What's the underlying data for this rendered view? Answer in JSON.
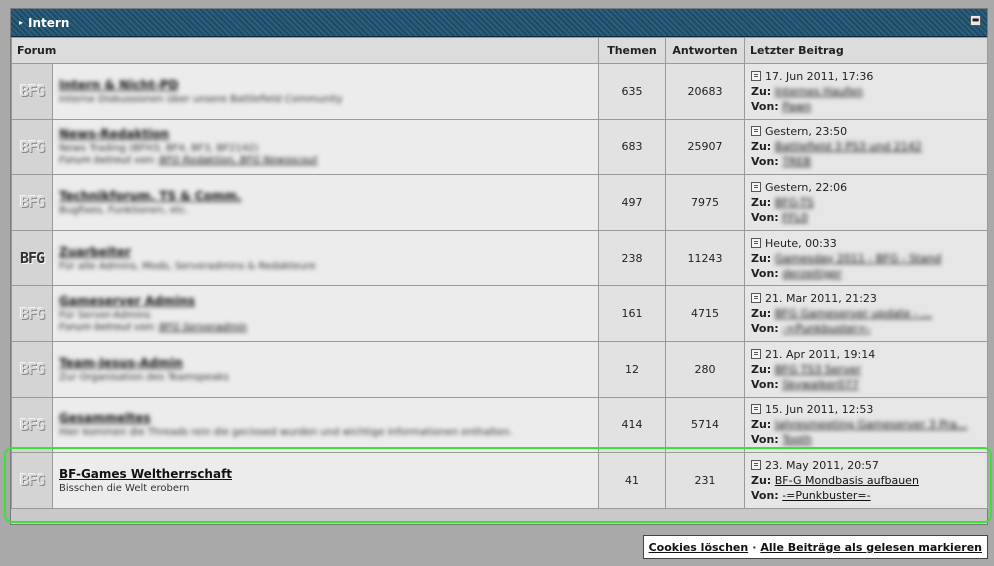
{
  "category": {
    "title": "Intern",
    "collapse_glyph": "▬"
  },
  "columns": {
    "forum": "Forum",
    "topics": "Themen",
    "replies": "Antworten",
    "last_post": "Letzter Beitrag"
  },
  "labels": {
    "to": "Zu:",
    "from": "Von:",
    "moderated_by": "Forum betreut von:"
  },
  "icon_text": "BFG",
  "forums": [
    {
      "name": "Intern & Nicht-PD",
      "desc": "Interne Diskussionen über unsere Battlefield Community",
      "mods": "",
      "topics": "635",
      "replies": "20683",
      "last_date": "17. Jun 2011, 17:36",
      "last_topic": "Internes Haufen",
      "last_user": "Pawn",
      "blurred": true,
      "dark_icon": false
    },
    {
      "name": "News-Redaktion",
      "desc": "News Trading (BFH3, BF4, BF3, BF2142)",
      "mods": "BFG Redaktion, BFG Newsscout",
      "topics": "683",
      "replies": "25907",
      "last_date": "Gestern, 23:50",
      "last_topic": "Battlefield 3 PS3 und 2142",
      "last_user": "TREB",
      "blurred": true,
      "dark_icon": false
    },
    {
      "name": "Technikforum, TS & Comm.",
      "desc": "Bugfixes, Funktionen, etc.",
      "mods": "",
      "topics": "497",
      "replies": "7975",
      "last_date": "Gestern, 22:06",
      "last_topic": "BFG-TS",
      "last_user": "FFL0",
      "blurred": true,
      "dark_icon": false
    },
    {
      "name": "Zuarbeiter",
      "desc": "Für alle Admins, Mods, Serveradmins & Redakteure",
      "mods": "",
      "topics": "238",
      "replies": "11243",
      "last_date": "Heute, 00:33",
      "last_topic": "Gamesday 2011 - BFG - Stand",
      "last_user": "derzeitiger",
      "blurred": true,
      "dark_icon": true
    },
    {
      "name": "Gameserver Admins",
      "desc": "Für Server-Admins",
      "mods": "BFG Serveradmin",
      "topics": "161",
      "replies": "4715",
      "last_date": "21. Mar 2011, 21:23",
      "last_topic": "BFG Gameserver update - ...",
      "last_user": "-=Punkbuster=-",
      "blurred": true,
      "dark_icon": false
    },
    {
      "name": "Team-Jesus-Admin",
      "desc": "Zur Organisation des Teamspeaks",
      "mods": "",
      "topics": "12",
      "replies": "280",
      "last_date": "21. Apr 2011, 19:14",
      "last_topic": "BFG TS3 Server",
      "last_user": "Skywalker077",
      "blurred": true,
      "dark_icon": false
    },
    {
      "name": "Gesammeltes",
      "desc": "Hier kommen die Threads rein die geclosed wurden und wichtige Informationen enthalten.",
      "mods": "",
      "topics": "414",
      "replies": "5714",
      "last_date": "15. Jun 2011, 12:53",
      "last_topic": "Jahresmeeting Gameserver 3 Pra...",
      "last_user": "Tooth",
      "blurred": true,
      "dark_icon": false
    },
    {
      "name": "BF-Games Weltherrschaft",
      "desc": "Bisschen die Welt erobern",
      "mods": "",
      "topics": "41",
      "replies": "231",
      "last_date": "23. May 2011, 20:57",
      "last_topic": "BF-G Mondbasis aufbauen",
      "last_user": "-=Punkbuster=-",
      "blurred": false,
      "dark_icon": false
    }
  ],
  "footer": {
    "delete_cookies": "Cookies löschen",
    "separator": "·",
    "mark_read": "Alle Beiträge als gelesen markieren"
  },
  "colors": {
    "highlight": "#3ee03a",
    "header_bg": "#1f4a63"
  }
}
